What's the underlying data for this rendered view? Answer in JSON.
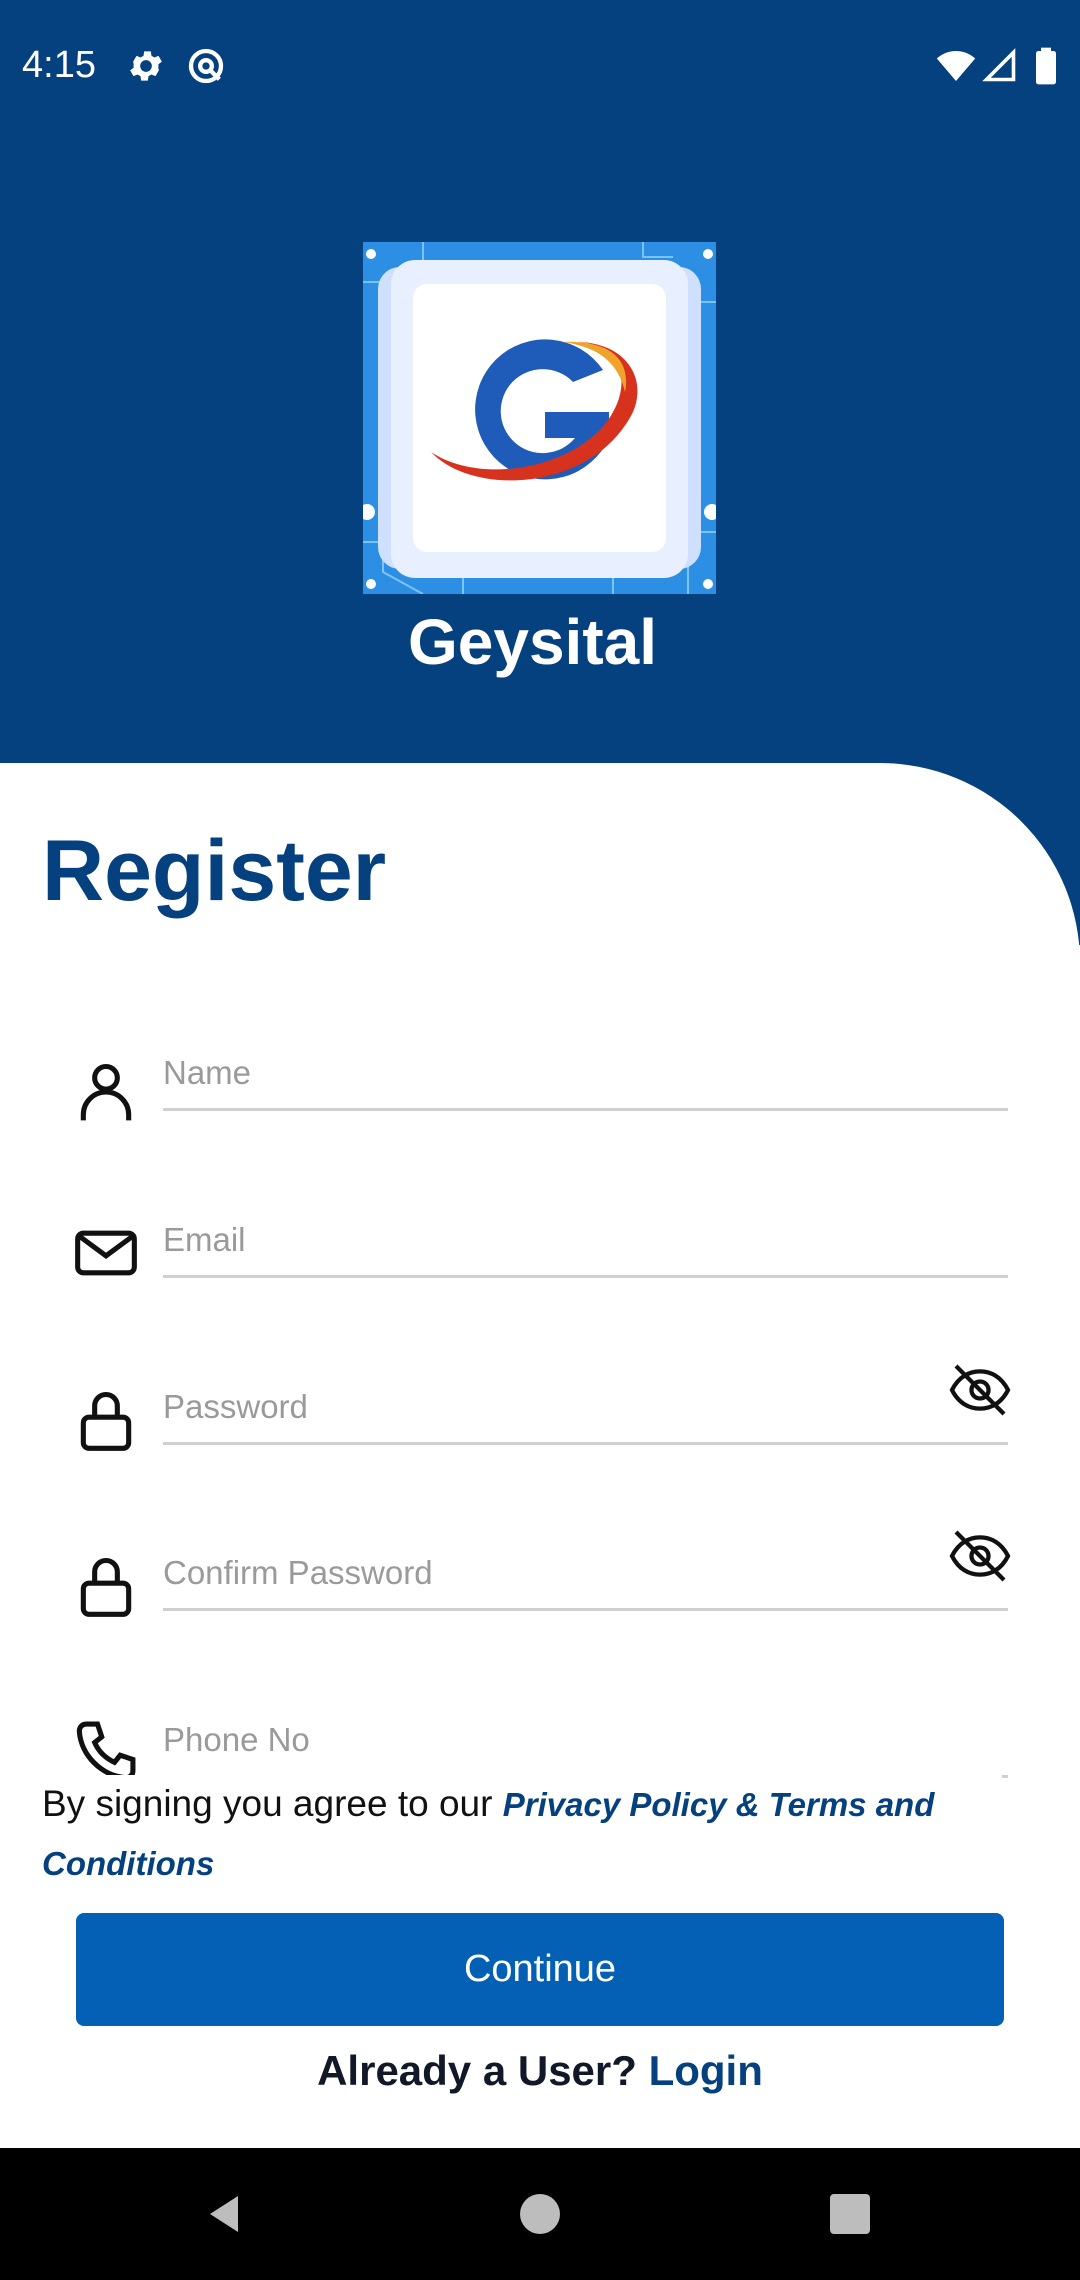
{
  "status_bar": {
    "time": "4:15",
    "icons_left": [
      "gear-icon",
      "at-sign-icon"
    ],
    "icons_right": [
      "wifi-icon",
      "cellular-signal-icon",
      "battery-icon"
    ]
  },
  "app": {
    "name": "Geysital",
    "logo_letter": "G"
  },
  "colors": {
    "primary_dark": "#05407f",
    "button_blue": "#0460b5",
    "placeholder": "#9a9a9a"
  },
  "form": {
    "title": "Register",
    "fields": [
      {
        "icon": "person-icon",
        "placeholder": "Name"
      },
      {
        "icon": "mail-icon",
        "placeholder": "Email"
      },
      {
        "icon": "lock-icon",
        "placeholder": "Password",
        "toggle": "eye-off-icon"
      },
      {
        "icon": "lock-icon",
        "placeholder": "Confirm Password",
        "toggle": "eye-off-icon"
      },
      {
        "icon": "phone-icon",
        "placeholder": "Phone No"
      }
    ]
  },
  "terms": {
    "prefix": "By signing you agree to our ",
    "link": "Privacy Policy & Terms and Conditions"
  },
  "continue_label": "Continue",
  "footer": {
    "prompt": "Already a User?",
    "login_label": "Login"
  },
  "nav_bar": [
    "back-icon",
    "home-icon",
    "recents-icon"
  ]
}
